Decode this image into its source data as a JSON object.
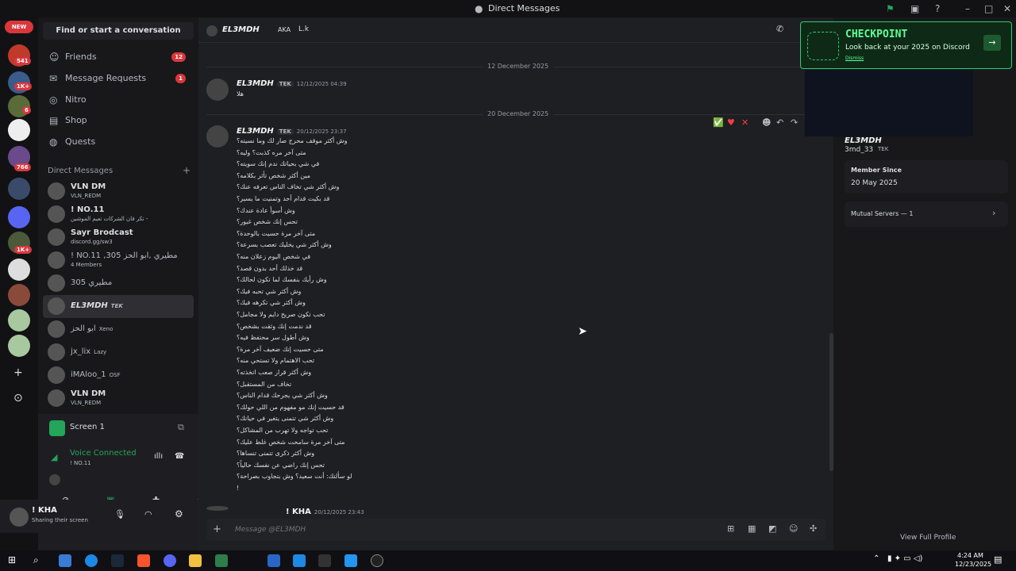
{
  "window": {
    "title": "Direct Messages"
  },
  "servers": {
    "new_badge": "NEW",
    "badges": [
      "541",
      "1K+",
      "6",
      "766",
      "1K+"
    ]
  },
  "sidebar": {
    "search_label": "Find or start a conversation",
    "nav": [
      {
        "label": "Friends",
        "count": "12"
      },
      {
        "label": "Message Requests",
        "count": "1"
      },
      {
        "label": "Nitro",
        "count": ""
      },
      {
        "label": "Shop",
        "count": ""
      },
      {
        "label": "Quests",
        "count": ""
      }
    ],
    "dm_header": "Direct Messages",
    "dms": [
      {
        "name": "VLN DM",
        "sub": "VLN_REDM",
        "tag": ""
      },
      {
        "name": "! NO.11",
        "sub": "تكر فان الشركات تعيم الموشين -",
        "tag": ""
      },
      {
        "name": "Sayr Brodcast",
        "sub": "discord.gg/sw3",
        "tag": ""
      },
      {
        "name": "! NO.11 ,305 مطيري ,ابو الحز",
        "sub": "4 Members",
        "tag": ""
      },
      {
        "name": "305 مطيري",
        "sub": "",
        "tag": ""
      },
      {
        "name": "EL3MDH",
        "sub": "",
        "tag": "TEK"
      },
      {
        "name": "ابو الحز",
        "sub": "",
        "tag": "Xeno"
      },
      {
        "name": "jx_lix",
        "sub": "",
        "tag": "Lazy"
      },
      {
        "name": "iMAloo_1",
        "sub": "",
        "tag": "OSF"
      },
      {
        "name": "VLN DM",
        "sub": "VLN_REDM",
        "tag": ""
      }
    ],
    "screen_label": "Screen 1",
    "voice": {
      "status": "Voice Connected",
      "channel": "! NO.11"
    },
    "user": {
      "name": "! KHA",
      "status": "Sharing their screen"
    }
  },
  "header": {
    "name": "EL3MDH",
    "aka_label": "AKA",
    "aka": "L.k"
  },
  "messages": {
    "date1": "12 December 2025",
    "date2": "20 December 2025",
    "m1": {
      "author": "EL3MDH",
      "tag": "TEK",
      "time": "12/12/2025 04:39",
      "text": "هلا"
    },
    "m2": {
      "author": "EL3MDH",
      "tag": "TEK",
      "time": "20/12/2025 23:37",
      "lines": [
        "وش أكثر موقف محرج صار لك وما نسيته؟",
        "متى آخر مره كذبت؟ وليه؟",
        "في شي بحياتك ندم إنك سويته؟",
        "مين أكثر شخص تأثر بكلامه؟",
        "وش أكثر شي تخاف الناس تعرفه عنك؟",
        "قد بكيت قدام أحد وتمنيت ما يسير؟",
        "وش أسوأ عادة عندك؟",
        "تحس إنك شخص غيور؟",
        "متى آخر مرة حسيت بالوحدة؟",
        "وش أكثر شي يخليك تعصب بسرعة؟",
        "في شخص اليوم زعلان منه؟",
        "قد خذلك أحد بدون قصد؟",
        "وش رأيك بنفسك لما تكون لحالك؟",
        "وش أكثر شي تحبه فيك؟",
        "وش أكثر شي تكرهه فيك؟",
        "تحب تكون صريح دايم ولا مجامل؟",
        "قد ندمت إنك وثقت بشخص؟",
        "وش أطول سر محتفظ فيه؟",
        "متى حسيت إنك ضعيف آخر مرة؟",
        "تحب الاهتمام ولا تستحي منه؟",
        "وش أكثر قرار صعب اتخذته؟",
        "تخاف من المستقبل؟",
        "وش أكثر شي يجرحك قدام الناس؟",
        "قد حسيت إنك مو مفهوم من اللي حولك؟",
        "وش أكثر شي تتمنى يتغير في حياتك؟",
        "تحب تواجه ولا تهرب من المشاكل؟",
        "متى آخر مرة سامحت شخص غلط عليك؟",
        "وش أكثر ذكرى تتمنى تنساها؟",
        "تحس إنك راضي عن نفسك حالياً؟",
        "لو سألتك: أنت سعيد؟ وش بتجاوب بصراحة؟",
        "!"
      ]
    },
    "m3": {
      "author": "! KHA",
      "time": "20/12/2025 23:43"
    },
    "composer_placeholder": "Message @EL3MDH"
  },
  "profile": {
    "name": "EL3MDH",
    "handle": "3md_33",
    "tag": "TEK",
    "member_since_label": "Member Since",
    "member_since": "20 May 2025",
    "mutual": "Mutual Servers — 1",
    "view_full": "View Full Profile"
  },
  "banner": {
    "title": "CHECKPOINT",
    "text": "Look back at your 2025 on Discord",
    "dismiss": "Dismiss"
  },
  "taskbar": {
    "time": "4:24 AM",
    "date": "12/23/2025"
  },
  "colors": {
    "accent": "#23a55a",
    "danger": "#da373c",
    "bg": "#1e1f22"
  }
}
